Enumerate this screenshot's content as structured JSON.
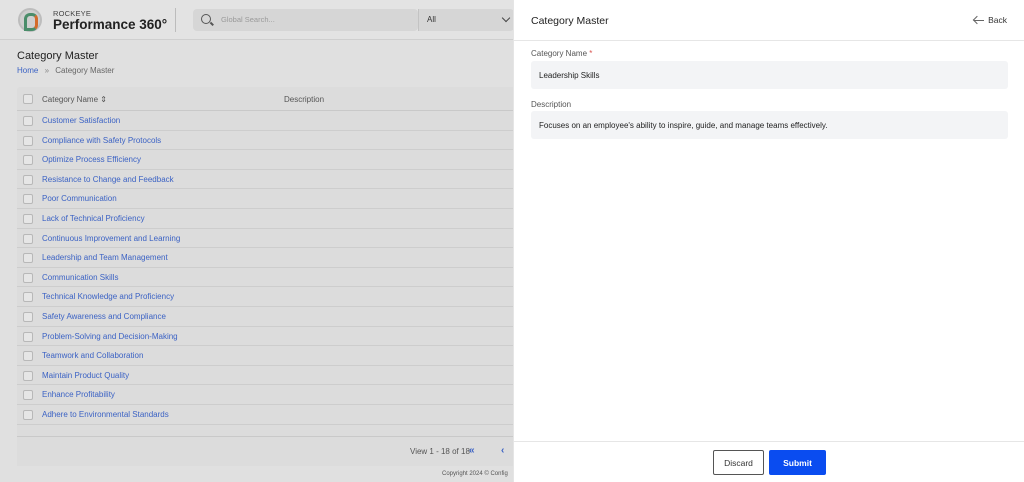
{
  "topbar": {
    "brand_top": "ROCKEYE",
    "brand_main": "Performance 360°",
    "search_placeholder": "Global Search...",
    "filter_value": "All"
  },
  "page": {
    "title": "Category Master",
    "breadcrumb": {
      "home": "Home",
      "separator": "»",
      "current": "Category Master"
    }
  },
  "table": {
    "columns": {
      "name": "Category Name ⇕",
      "description": "Description"
    },
    "rows": [
      "Customer Satisfaction",
      "Compliance with Safety Protocols",
      "Optimize Process Efficiency",
      "Resistance to Change and Feedback",
      "Poor Communication",
      "Lack of Technical Proficiency",
      "Continuous Improvement and Learning",
      "Leadership and Team Management",
      "Communication Skills",
      "Technical Knowledge and Proficiency",
      "Safety Awareness and Compliance",
      "Problem-Solving and Decision-Making",
      "Teamwork and Collaboration",
      "Maintain Product Quality",
      "Enhance Profitability",
      "Adhere to Environmental Standards"
    ],
    "pager": {
      "text": "View 1 - 18 of 18",
      "first": "«",
      "prev": "‹"
    }
  },
  "copyright": "Copyright 2024 © Config",
  "panel": {
    "title": "Category Master",
    "back_label": "Back",
    "fields": {
      "category_name_label": "Category Name",
      "required_mark": "*",
      "category_name_value": "Leadership Skills",
      "description_label": "Description",
      "description_value": "Focuses on an employee's ability to inspire, guide, and manage teams effectively."
    },
    "buttons": {
      "discard": "Discard",
      "submit": "Submit"
    }
  },
  "colors": {
    "accent": "#0a4cf0",
    "link": "#3b62c4"
  }
}
